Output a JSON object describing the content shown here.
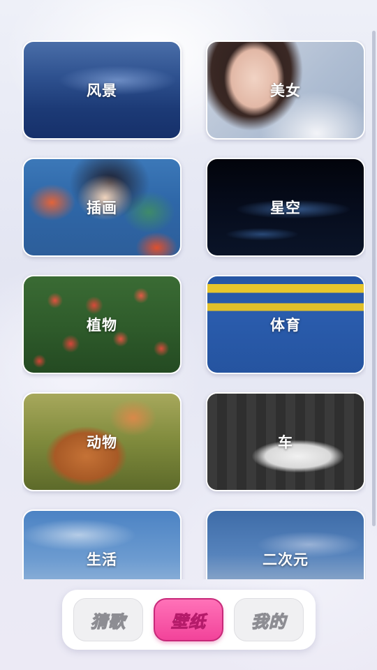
{
  "categories": [
    {
      "label": "风景"
    },
    {
      "label": "美女"
    },
    {
      "label": "插画"
    },
    {
      "label": "星空"
    },
    {
      "label": "植物"
    },
    {
      "label": "体育"
    },
    {
      "label": "动物"
    },
    {
      "label": "车"
    },
    {
      "label": "生活"
    },
    {
      "label": "二次元"
    }
  ],
  "nav": {
    "tabs": [
      {
        "label": "猜歌"
      },
      {
        "label": "壁纸"
      },
      {
        "label": "我的"
      }
    ],
    "active_tab": "壁纸"
  },
  "colors": {
    "accent": "#f2439a",
    "accent_border": "#c72879",
    "inactive_tab_bg": "#f0f0f2"
  }
}
